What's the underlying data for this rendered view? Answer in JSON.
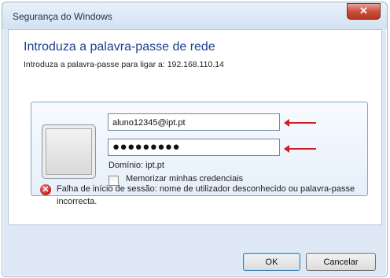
{
  "window": {
    "title": "Segurança do Windows",
    "close_symbol": "✕"
  },
  "header": {
    "heading": "Introduza a palavra-passe de rede",
    "subheading": "Introduza a palavra-passe para ligar a: 192.168.110.14"
  },
  "credentials": {
    "username_value": "aluno12345@ipt.pt",
    "password_value": "●●●●●●●●●",
    "domain_text": "Domínio: ipt.pt",
    "remember_label": "Memorizar minhas credenciais",
    "remember_checked": false
  },
  "error": {
    "message": "Falha de início de sessão: nome de utilizador desconhecido ou palavra-passe incorrecta.",
    "icon_symbol": "✕"
  },
  "buttons": {
    "ok": "OK",
    "cancel": "Cancelar"
  },
  "colors": {
    "heading": "#1e3f8f",
    "annotation_arrow": "#d21d1d",
    "close_button": "#c8503d"
  }
}
